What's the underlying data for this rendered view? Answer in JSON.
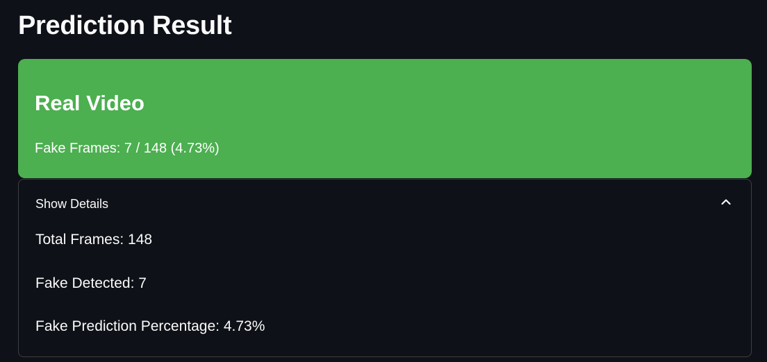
{
  "page": {
    "title": "Prediction Result"
  },
  "result": {
    "heading": "Real Video",
    "summary": "Fake Frames: 7 / 148 (4.73%)",
    "status_color": "#4caf50"
  },
  "details": {
    "header_label": "Show Details",
    "expanded": true,
    "toggle_icon": "chevron-up-icon",
    "lines": [
      "Total Frames: 148",
      "Fake Detected: 7",
      "Fake Prediction Percentage: 4.73%"
    ]
  },
  "theme": {
    "background": "#0e1117",
    "text": "#fafafa"
  }
}
